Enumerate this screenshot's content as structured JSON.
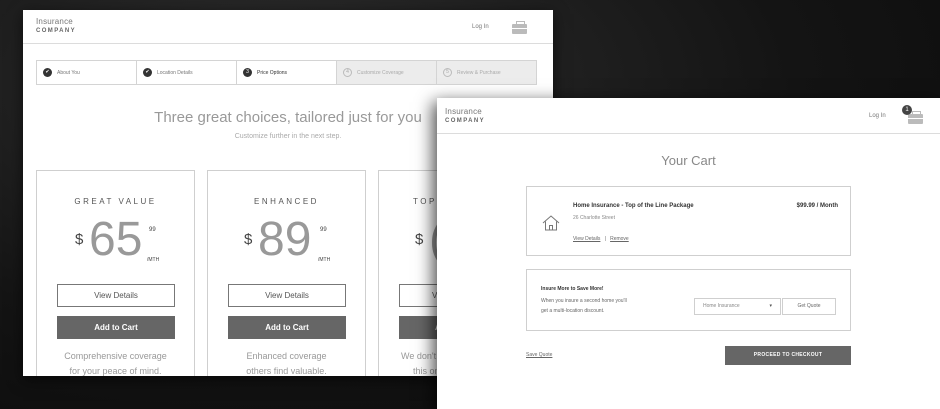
{
  "back_window": {
    "logo_line1": "Insurance",
    "logo_line2": "COMPANY",
    "login": "Log In",
    "steps": [
      {
        "label": "About You",
        "marker": "✔",
        "state": "done"
      },
      {
        "label": "Location Details",
        "marker": "✔",
        "state": "done"
      },
      {
        "label": "Price Options",
        "marker": "3",
        "state": "current"
      },
      {
        "label": "Customize Coverage",
        "marker": "4",
        "state": "disabled"
      },
      {
        "label": "Review & Purchase",
        "marker": "5",
        "state": "disabled"
      }
    ],
    "headline": "Three great choices, tailored just for you",
    "subline": "Customize further in the next step.",
    "cards": [
      {
        "title": "GREAT VALUE",
        "currency": "$",
        "amount": "65",
        "cents": "99",
        "per": "/MTH",
        "view_label": "View Details",
        "add_label": "Add to Cart",
        "desc_line1": "Comprehensive coverage",
        "desc_line2": "for your peace of mind."
      },
      {
        "title": "ENHANCED",
        "currency": "$",
        "amount": "89",
        "cents": "99",
        "per": "/MTH",
        "view_label": "View Details",
        "add_label": "Add to Cart",
        "desc_line1": "Enhanced coverage",
        "desc_line2": "others find valuable."
      },
      {
        "title": "TOP O",
        "currency": "$",
        "amount": "(",
        "cents": "",
        "per": "",
        "view_label": "V",
        "add_label": "A",
        "desc_line1": "We don't",
        "desc_line2": "this on"
      }
    ]
  },
  "front_window": {
    "logo_line1": "Insurance",
    "logo_line2": "COMPANY",
    "login": "Log In",
    "cart_count": "1",
    "title": "Your Cart",
    "item": {
      "name": "Home Insurance - Top of the Line Package",
      "price": "$99.99 / Month",
      "address": "26 Charlotte Street",
      "view_details": "View Details",
      "separator": "|",
      "remove": "Remove"
    },
    "promo": {
      "heading": "Insure More to Save More!",
      "text_line1": "When you insure a second home you'll",
      "text_line2": "get a multi-location discount.",
      "select_value": "Home Insurance",
      "select_caret": "▾",
      "quote_button": "Get Quote"
    },
    "save_quote": "Save Quote",
    "checkout": "PROCEED TO CHECKOUT"
  }
}
